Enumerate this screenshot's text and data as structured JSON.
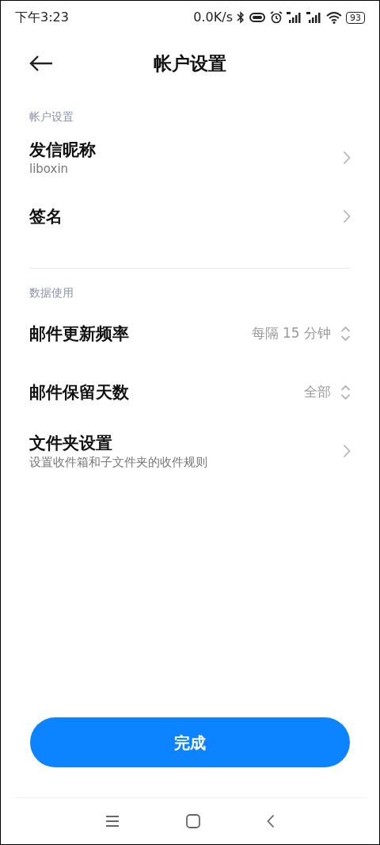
{
  "status_bar": {
    "time": "下午3:23",
    "speed": "0.0K/s",
    "battery": "93"
  },
  "header": {
    "title": "帐户设置"
  },
  "sections": [
    {
      "title": "帐户设置",
      "items": [
        {
          "kind": "link",
          "label": "发信昵称",
          "subtitle": "liboxin"
        },
        {
          "kind": "link",
          "label": "签名"
        }
      ]
    },
    {
      "title": "数据使用",
      "items": [
        {
          "kind": "select",
          "label": "邮件更新频率",
          "value": "每隔 15 分钟"
        },
        {
          "kind": "select",
          "label": "邮件保留天数",
          "value": "全部"
        },
        {
          "kind": "link",
          "label": "文件夹设置",
          "subtitle": "设置收件箱和子文件夹的收件规则"
        }
      ]
    }
  ],
  "done_button": {
    "label": "完成"
  }
}
